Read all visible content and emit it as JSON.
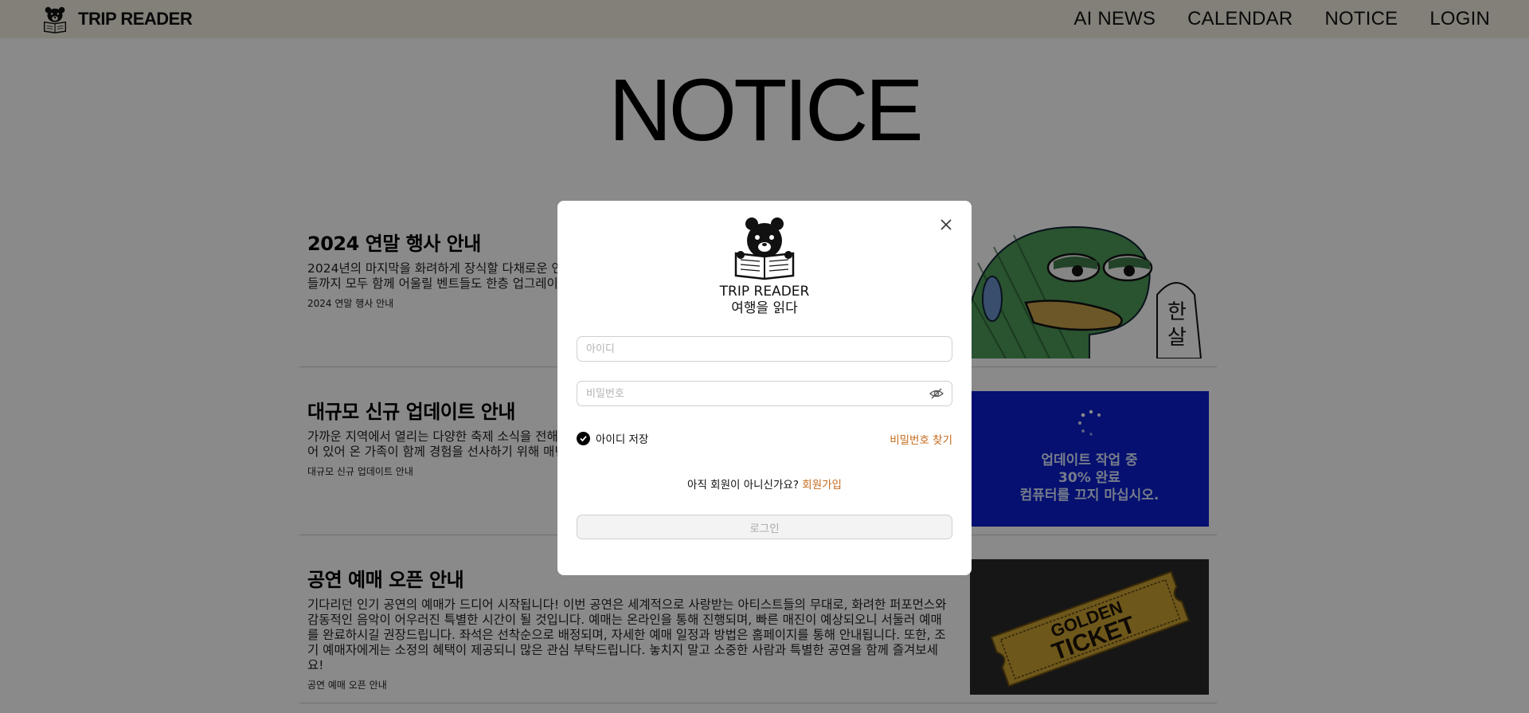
{
  "header": {
    "brand": "TRIP READER",
    "nav": [
      "AI NEWS",
      "CALENDAR",
      "NOTICE",
      "LOGIN"
    ]
  },
  "page": {
    "title": "NOTICE"
  },
  "notices": [
    {
      "title": "2024 연말 행사 안내",
      "body": "2024년의 마지막을 화려하게 장식할 다채로운 연 공연, 빛나는 조명축제, 맛있는 푸드트럭이 가득한 주민뿐만 아니라 방문객들까지 모두 함께 어울릴 벤트들도 한층 업그레이드되었습니다. 자세한 일 억을 만들어보세요!",
      "footer": "2024 연말 행사 안내",
      "thumb": "frog-sticker"
    },
    {
      "title": "대규모 신규 업데이트 안내",
      "body": "가까운 지역에서 열리는 다양한 축제 소식을 전해 지역 특산물 체험 등 다채로운 프로그램이 펼쳐질 한 특별 이벤트가 준비되어 있어 온 가족이 함께 경험을 선사하기 위해 매년 열리고 있습니다. 축제 실 수 있습니다. 많은 관심과 참여 바랍니다!",
      "footer": "대규모 신규 업데이트 안내",
      "thumb": "update-screen",
      "thumb_text": [
        "업데이트 작업 중",
        "30% 완료",
        "컴퓨터를 끄지 마십시오."
      ]
    },
    {
      "title": "공연 예매 오픈 안내",
      "body": "기다리던 인기 공연의 예매가 드디어 시작됩니다! 이번 공연은 세계적으로 사랑받는 아티스트들의 무대로, 화려한 퍼포먼스와 감동적인 음악이 어우러진 특별한 시간이 될 것입니다. 예매는 온라인을 통해 진행되며, 빠른 매진이 예상되오니 서둘러 예매를 완료하시길 권장드립니다. 좌석은 선착순으로 배정되며, 자세한 예매 일정과 방법은 홈페이지를 통해 안내됩니다. 또한, 조기 예매자에게는 소정의 혜택이 제공되니 많은 관심 부탁드립니다. 놓치지 말고 소중한 사람과 특별한 공연을 함께 즐겨보세요!",
      "footer": "공연 예매 오픈 안내",
      "thumb": "golden-ticket",
      "thumb_text": [
        "GOLDEN",
        "TICKET"
      ]
    }
  ],
  "modal": {
    "brand_en": "TRIP READER",
    "brand_ko": "여행을 읽다",
    "id_placeholder": "아이디",
    "pw_placeholder": "비밀번호",
    "remember_label": "아이디 저장",
    "remember_checked": true,
    "find_password": "비밀번호 찾기",
    "signup_prompt": "아직 회원이 아니신가요?",
    "signup_link": "회원가입",
    "login_button": "로그인"
  },
  "colors": {
    "header_bg": "#f2ece0",
    "accent_link": "#c56a1c",
    "overlay": "rgba(0,0,0,0.46)",
    "update_bg": "#0b1fd0"
  }
}
